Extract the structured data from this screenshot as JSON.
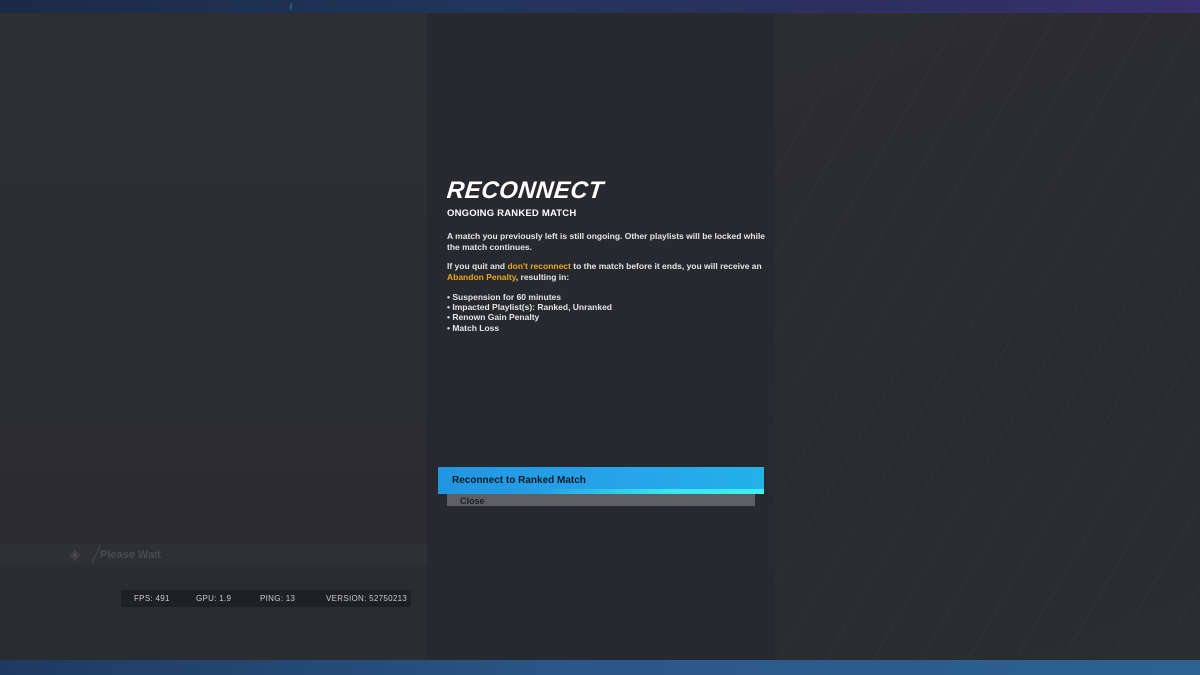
{
  "dialog": {
    "title": "RECONNECT",
    "subtitle": "ONGOING RANKED MATCH",
    "paragraph1": "A match you previously left is still ongoing. Other playlists will be locked while the match continues.",
    "paragraph2": {
      "part1": "If you quit and ",
      "highlight1": "don't reconnect",
      "part2": " to the match before it ends, you will receive an ",
      "highlight2": "Abandon Penalty",
      "part3": ", resulting in:"
    },
    "penalties": [
      "Suspension for 60 minutes",
      "Impacted Playlist(s): Ranked, Unranked",
      "Renown Gain Penalty",
      "Match Loss"
    ],
    "primary_button": "Reconnect to Ranked Match",
    "close_button": "Close"
  },
  "background_bar": {
    "label": "Please Wait"
  },
  "stats": {
    "fps": "FPS: 491",
    "gpu": "GPU: 1.9",
    "ping": "PING: 13",
    "version": "VERSION: 52750213"
  },
  "colors": {
    "accent": "#e8a81e",
    "primary_button": "#27a4ea",
    "panel": "#28292e"
  }
}
